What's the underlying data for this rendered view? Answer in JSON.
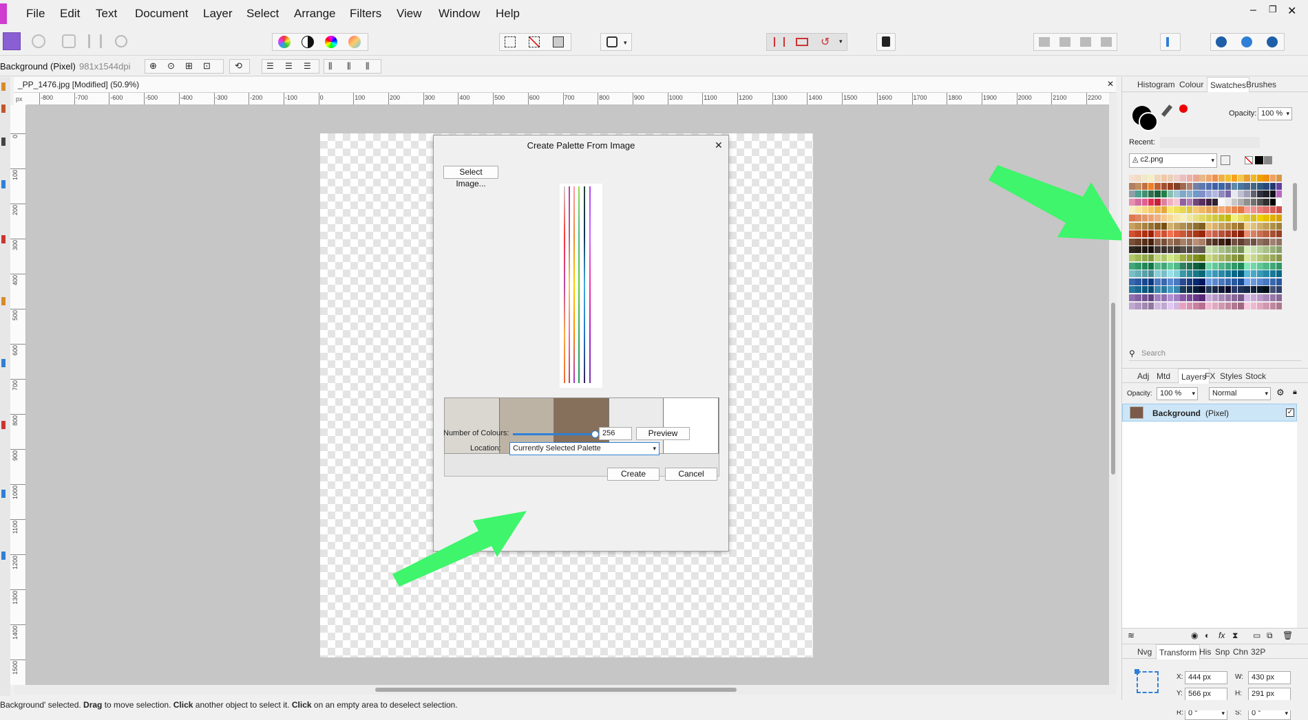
{
  "menubar": {
    "items": [
      "File",
      "Edit",
      "Text",
      "Document",
      "Layer",
      "Select",
      "Arrange",
      "Filters",
      "View",
      "Window",
      "Help"
    ],
    "window_controls": [
      "–",
      "❐",
      "✕"
    ]
  },
  "toolbar": {
    "icons": [
      "personas-photo-icon",
      "liquify-persona-icon",
      "develop-persona-icon",
      "tone-mapping-icon",
      "export-persona-icon",
      "colour-wheel-icon",
      "contrast-icon",
      "hsl-icon",
      "gradient-icon",
      "marquee-icon",
      "no-selection-icon",
      "refine-icon",
      "shape-icon",
      "snapping-icon",
      "undo-icon",
      "delete-icon"
    ]
  },
  "context_bar": {
    "layer_name": "Background (Pixel)",
    "dimensions": "981x1544dpi"
  },
  "document_tab": {
    "title": "_PP_1476.jpg [Modified] (50.9%)",
    "close": "✕"
  },
  "ruler": {
    "unit": "px",
    "top_ticks": [
      "-800",
      "-700",
      "-600",
      "-500",
      "-400",
      "-300",
      "-200",
      "-100",
      "0",
      "100",
      "200",
      "300",
      "400",
      "500",
      "600",
      "700",
      "800",
      "900",
      "1000",
      "1100",
      "1200",
      "1300",
      "1400",
      "1500",
      "1600",
      "1700",
      "1800",
      "1900",
      "2000",
      "2100",
      "2200"
    ],
    "left_ticks": [
      "0",
      "100",
      "200",
      "300",
      "400",
      "500",
      "600",
      "700",
      "800",
      "900",
      "1000",
      "1100",
      "1200",
      "1300",
      "1400",
      "1500"
    ]
  },
  "dialog": {
    "title": "Create Palette From Image",
    "close": "✕",
    "select_image_label": "Select Image...",
    "palette_colors": [
      "#dad7d1",
      "#bcb3a5",
      "#86705b",
      "#ebebeb",
      "#ffffff"
    ],
    "num_colours_label": "Number of Colours:",
    "num_colours_value": "256",
    "num_colours_fraction": 1.0,
    "preview_label": "Preview",
    "location_label": "Location:",
    "location_value": "Currently Selected Palette",
    "create_label": "Create",
    "cancel_label": "Cancel"
  },
  "status": {
    "parts": [
      {
        "text": "Background' selected. ",
        "bold": false
      },
      {
        "text": "Drag",
        "bold": true
      },
      {
        "text": " to move selection. ",
        "bold": false
      },
      {
        "text": "Click",
        "bold": true
      },
      {
        "text": " another object to select it. ",
        "bold": false
      },
      {
        "text": "Click",
        "bold": true
      },
      {
        "text": " on an empty area to deselect selection.",
        "bold": false
      }
    ]
  },
  "panel_top": {
    "tabs": [
      "Histogram",
      "Colour",
      "Swatches",
      "Brushes"
    ],
    "active_tab": "Swatches",
    "opacity_label": "Opacity:",
    "opacity_value": "100 %",
    "recent_label": "Recent:",
    "palette_name": "c2.png",
    "search_placeholder": "Search"
  },
  "panel_layers": {
    "tabs": [
      "Adj",
      "Mtd",
      "Layers",
      "FX",
      "Styles",
      "Stock"
    ],
    "active_tab": "Layers",
    "opacity_label": "Opacity:",
    "opacity_value": "100 %",
    "blend_mode": "Normal",
    "layer_name": "Background",
    "layer_type": "(Pixel)"
  },
  "panel_transform": {
    "tabs": [
      "Nvg",
      "Transform",
      "His",
      "Snp",
      "Chn",
      "32P"
    ],
    "active_tab": "Transform",
    "x_label": "X:",
    "x_value": "444 px",
    "y_label": "Y:",
    "y_value": "566 px",
    "w_label": "W:",
    "w_value": "430 px",
    "h_label": "H:",
    "h_value": "291 px",
    "r_label": "R:",
    "r_value": "0 °",
    "s_label": "S:",
    "s_value": "0 °"
  },
  "colors": {
    "accent_tab": "#ffffff",
    "arrow": "#3ef56b",
    "layer_selected": "#cde6f7",
    "slider": "#2f7fd6"
  }
}
